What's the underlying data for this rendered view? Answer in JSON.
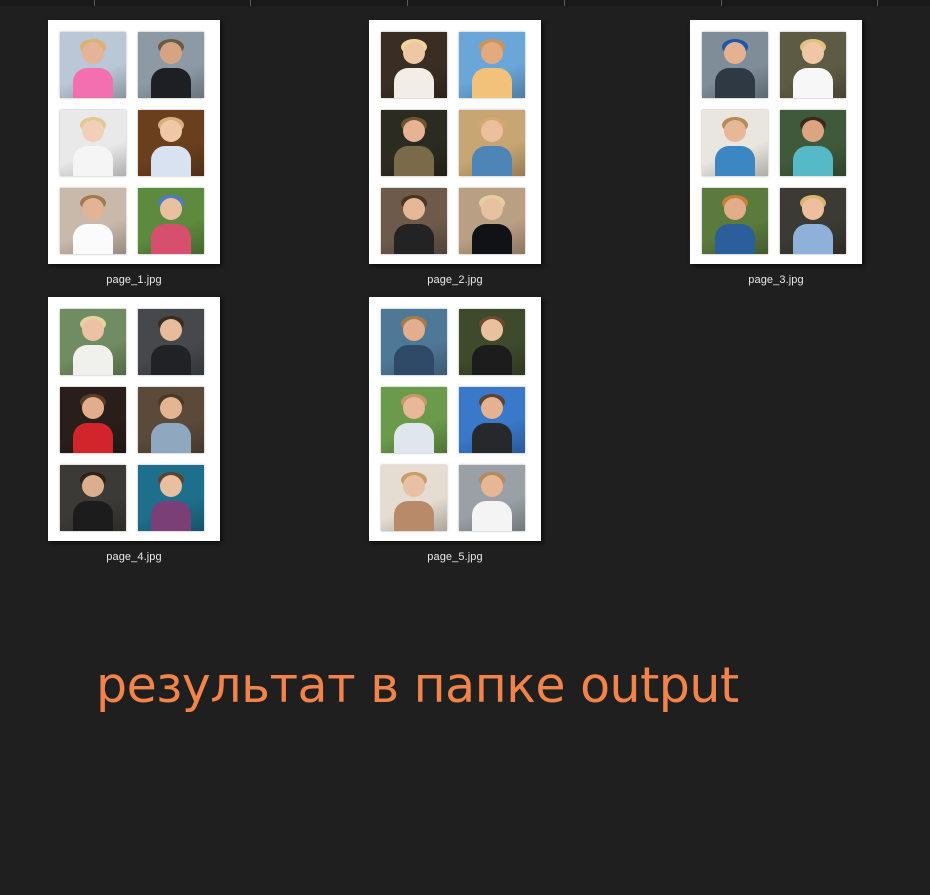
{
  "window": {
    "background": "#1f1f1f"
  },
  "files": [
    {
      "name": "page_1.jpg",
      "photos": [
        {
          "bg": "#b9c7d6",
          "skin": "#e4b39a",
          "cloth": "#f36fb0",
          "hair": "#d9b26d"
        },
        {
          "bg": "#8d9aa5",
          "skin": "#d7a483",
          "cloth": "#1d1f24",
          "hair": "#6b5a44"
        },
        {
          "bg": "#e9e9ea",
          "skin": "#f1cfb8",
          "cloth": "#f5f5f5",
          "hair": "#e2c98f"
        },
        {
          "bg": "#6a3f1e",
          "skin": "#efc9a7",
          "cloth": "#d8e2f0",
          "hair": "#d4b07a"
        },
        {
          "bg": "#c9b9aa",
          "skin": "#e2b394",
          "cloth": "#fbfbfb",
          "hair": "#a07a52"
        },
        {
          "bg": "#5e8a3f",
          "skin": "#e9c1a0",
          "cloth": "#d64f6d",
          "hair": "#4d7dc0"
        }
      ]
    },
    {
      "name": "page_2.jpg",
      "photos": [
        {
          "bg": "#3a2e24",
          "skin": "#f0c7a4",
          "cloth": "#f2ede6",
          "hair": "#f0d69a"
        },
        {
          "bg": "#6aa6d8",
          "skin": "#e3aa7d",
          "cloth": "#f2c27a",
          "hair": "#c8955f"
        },
        {
          "bg": "#2b2b22",
          "skin": "#e6b495",
          "cloth": "#7b6a4a",
          "hair": "#6e5432"
        },
        {
          "bg": "#c7a673",
          "skin": "#ecbf9e",
          "cloth": "#4f84b6",
          "hair": "#d3a970"
        },
        {
          "bg": "#6d5a4b",
          "skin": "#e7b898",
          "cloth": "#232323",
          "hair": "#4a3422"
        },
        {
          "bg": "#b99f84",
          "skin": "#e8c0a2",
          "cloth": "#101216",
          "hair": "#e5cf9f"
        }
      ]
    },
    {
      "name": "page_3.jpg",
      "photos": [
        {
          "bg": "#7f8d98",
          "skin": "#e4b193",
          "cloth": "#2f3944",
          "hair": "#1e57a8"
        },
        {
          "bg": "#5e5b44",
          "skin": "#efc6a6",
          "cloth": "#f7f7f7",
          "hair": "#e0c27d"
        },
        {
          "bg": "#e9e6df",
          "skin": "#e6b898",
          "cloth": "#3d86c4",
          "hair": "#b68a5b"
        },
        {
          "bg": "#3f5a3a",
          "skin": "#dca582",
          "cloth": "#56b9c8",
          "hair": "#3a2a1e"
        },
        {
          "bg": "#5b7a3e",
          "skin": "#e2ad8b",
          "cloth": "#2c5e9c",
          "hair": "#c97e3c"
        },
        {
          "bg": "#3b3a34",
          "skin": "#eebf9f",
          "cloth": "#8fb0d8",
          "hair": "#d9b46e"
        }
      ]
    },
    {
      "name": "page_4.jpg",
      "photos": [
        {
          "bg": "#6f8c62",
          "skin": "#ebc3a4",
          "cloth": "#f0f0ed",
          "hair": "#e6d49c"
        },
        {
          "bg": "#46484c",
          "skin": "#e7bc9d",
          "cloth": "#202226",
          "hair": "#3a2c1e"
        },
        {
          "bg": "#2a1e1b",
          "skin": "#e2ad8c",
          "cloth": "#d1242b",
          "hair": "#5a3c28"
        },
        {
          "bg": "#5b4a3a",
          "skin": "#e4b595",
          "cloth": "#8fa7bf",
          "hair": "#4d3826"
        },
        {
          "bg": "#3b3a36",
          "skin": "#dcae90",
          "cloth": "#1c1c1c",
          "hair": "#2c2219"
        },
        {
          "bg": "#1e6f8c",
          "skin": "#e8bfa0",
          "cloth": "#7a3f76",
          "hair": "#5b4330"
        }
      ]
    },
    {
      "name": "page_5.jpg",
      "photos": [
        {
          "bg": "#4f7896",
          "skin": "#e2ae8d",
          "cloth": "#2e4a66",
          "hair": "#a57a4e"
        },
        {
          "bg": "#3f4a2c",
          "skin": "#ebc09f",
          "cloth": "#1c1c1c",
          "hair": "#6c4a2f"
        },
        {
          "bg": "#6a9a4a",
          "skin": "#e8b898",
          "cloth": "#dfe6ee",
          "hair": "#c59a6a"
        },
        {
          "bg": "#3a78c9",
          "skin": "#e4b192",
          "cloth": "#26282b",
          "hair": "#5a4432"
        },
        {
          "bg": "#e5ddd2",
          "skin": "#e8c0a3",
          "cloth": "#b98a6a",
          "hair": "#c99d69"
        },
        {
          "bg": "#9aa0a5",
          "skin": "#e7b695",
          "cloth": "#f4f4f4",
          "hair": "#b58a5c"
        }
      ]
    }
  ],
  "caption": {
    "text": "результат в папке output",
    "color": "#f2834a"
  }
}
